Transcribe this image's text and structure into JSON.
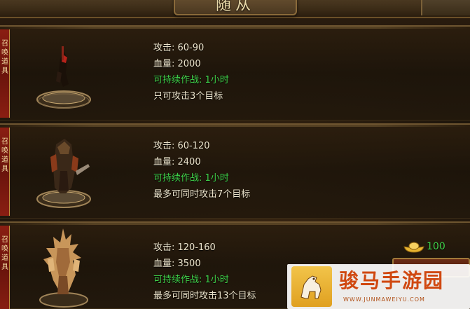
{
  "header": {
    "title": "随从"
  },
  "followers": [
    {
      "side_label": "召唤道具",
      "stats": [
        {
          "text": "攻击: 60-90",
          "color": "plain"
        },
        {
          "text": "血量: 2000",
          "color": "plain"
        },
        {
          "text": "可持续作战: 1小时",
          "color": "green"
        },
        {
          "text": "只可攻击3个目标",
          "color": "plain"
        }
      ]
    },
    {
      "side_label": "召唤道具",
      "stats": [
        {
          "text": "攻击: 60-120",
          "color": "plain"
        },
        {
          "text": "血量: 2400",
          "color": "plain"
        },
        {
          "text": "可持续作战: 1小时",
          "color": "green"
        },
        {
          "text": "最多可同时攻击7个目标",
          "color": "plain"
        }
      ]
    },
    {
      "side_label": "召唤道具",
      "stats": [
        {
          "text": "攻击: 120-160",
          "color": "plain"
        },
        {
          "text": "血量: 3500",
          "color": "plain"
        },
        {
          "text": "可持续作战: 1小时",
          "color": "green"
        },
        {
          "text": "最多可同时攻击13个目标",
          "color": "plain"
        }
      ]
    }
  ],
  "reward": {
    "value": "100",
    "icon": "gold-ingot-icon"
  },
  "watermark": {
    "cn": "骏马手游园",
    "en": "WWW.JUNMAWEIYU.COM"
  },
  "colors": {
    "gold": "#e8d8a8",
    "green": "#3fd24a",
    "text": "#ece4cc",
    "tab_red": "#8a1e12"
  }
}
